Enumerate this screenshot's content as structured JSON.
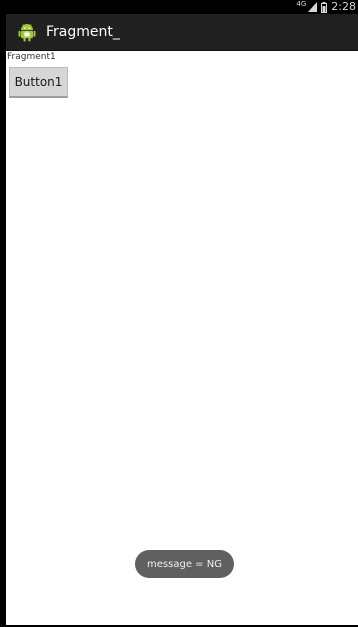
{
  "status_bar": {
    "network": "4G",
    "time": "2:28",
    "icons": [
      "signal-icon",
      "battery-icon"
    ]
  },
  "action_bar": {
    "title": "Fragment_",
    "icon": "android-app-icon"
  },
  "fragment": {
    "label": "Fragment1",
    "button_label": "Button1"
  },
  "toast": {
    "message": "message = NG"
  },
  "colors": {
    "status_bar": "#000000",
    "action_bar": "#212121",
    "content_bg": "#ffffff",
    "button_bg": "#d6d6d6",
    "toast_bg": "#606060",
    "android_green": "#a4c639"
  }
}
